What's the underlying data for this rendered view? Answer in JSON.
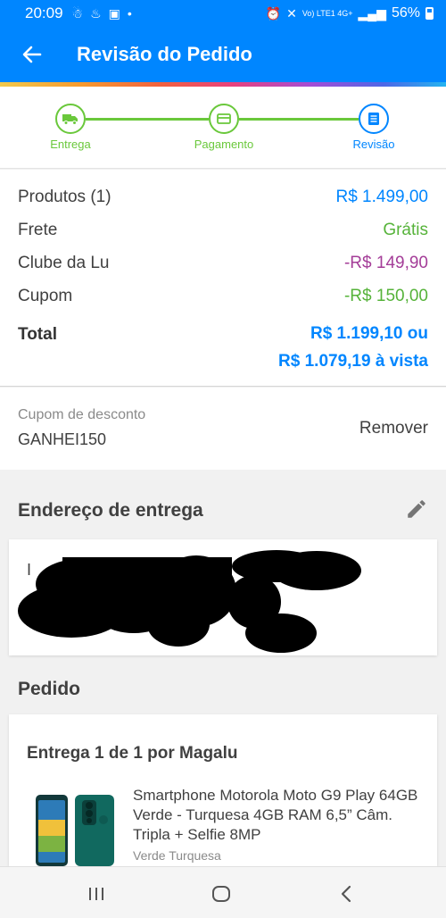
{
  "status_bar": {
    "time": "20:09",
    "network": "Vo) LTE1 4G+",
    "battery": "56%"
  },
  "app_bar": {
    "title": "Revisão do Pedido"
  },
  "stepper": {
    "steps": [
      {
        "label": "Entrega",
        "icon": "truck-icon",
        "state": "done"
      },
      {
        "label": "Pagamento",
        "icon": "card-icon",
        "state": "done"
      },
      {
        "label": "Revisão",
        "icon": "document-icon",
        "state": "current"
      }
    ]
  },
  "summary": {
    "products_label": "Produtos (1)",
    "products_value": "R$ 1.499,00",
    "shipping_label": "Frete",
    "shipping_value": "Grátis",
    "club_label": "Clube da Lu",
    "club_value": "-R$ 149,90",
    "coupon_label": "Cupom",
    "coupon_value": "-R$ 150,00",
    "total_label": "Total",
    "total_value_line1": "R$ 1.199,10 ou",
    "total_value_line2": "R$ 1.079,19 à vista"
  },
  "coupon": {
    "label": "Cupom de desconto",
    "code": "GANHEI150",
    "remove_label": "Remover"
  },
  "address": {
    "section_title": "Endereço de entrega",
    "edit_icon": "pencil-icon",
    "visible_letter": "I"
  },
  "order": {
    "section_title": "Pedido",
    "delivery_title": "Entrega 1 de 1 por Magalu",
    "product_name": "Smartphone Motorola Moto G9 Play 64GB Verde - Turquesa 4GB RAM 6,5” Câm. Tripla + Selfie 8MP",
    "product_variant": "Verde Turquesa"
  },
  "colors": {
    "primary": "#0086ff",
    "success": "#56b33a",
    "club": "#a43d98",
    "step_green": "#6ac83b"
  }
}
